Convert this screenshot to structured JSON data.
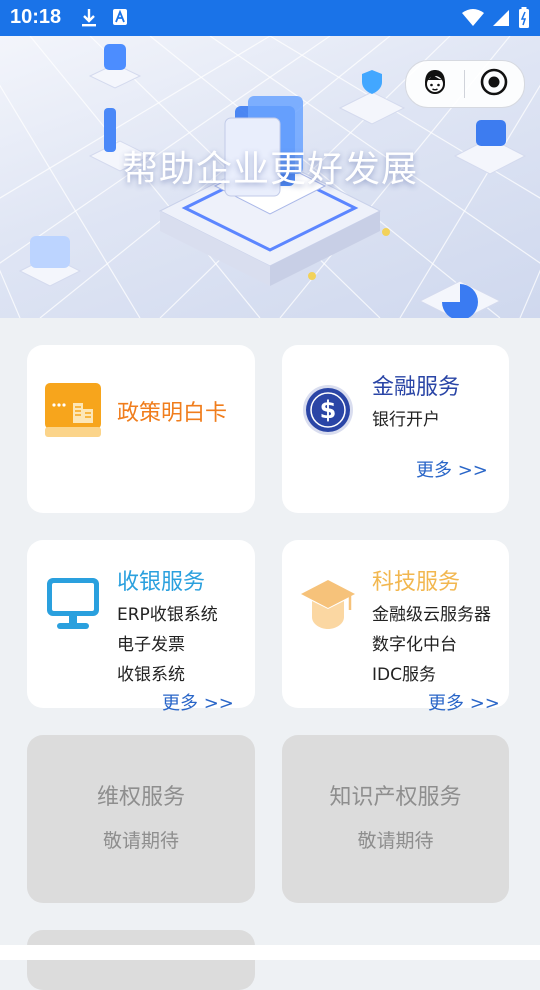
{
  "status_bar": {
    "time": "10:18"
  },
  "hero": {
    "title": "帮助企业更好发展"
  },
  "cards": {
    "policy": {
      "title": "政策明白卡"
    },
    "finance": {
      "title": "金融服务",
      "items": [
        "银行开户"
      ],
      "more": "更多 >>"
    },
    "cashier": {
      "title": "收银服务",
      "items": [
        "ERP收银系统",
        "电子发票",
        "收银系统"
      ],
      "more": "更多 >>"
    },
    "tech": {
      "title": "科技服务",
      "items": [
        "金融级云服务器",
        "数字化中台",
        "IDC服务"
      ],
      "more": "更多 >>"
    },
    "rights": {
      "title": "维权服务",
      "subtitle": "敬请期待"
    },
    "ip": {
      "title": "知识产权服务",
      "subtitle": "敬请期待"
    }
  },
  "colors": {
    "status_bar": "#1a73e8",
    "policy_title": "#f07d1c",
    "finance_title": "#2a45a6",
    "cashier_title": "#2aa0de",
    "tech_title": "#f2b74f",
    "more_link": "#2a66c8"
  }
}
